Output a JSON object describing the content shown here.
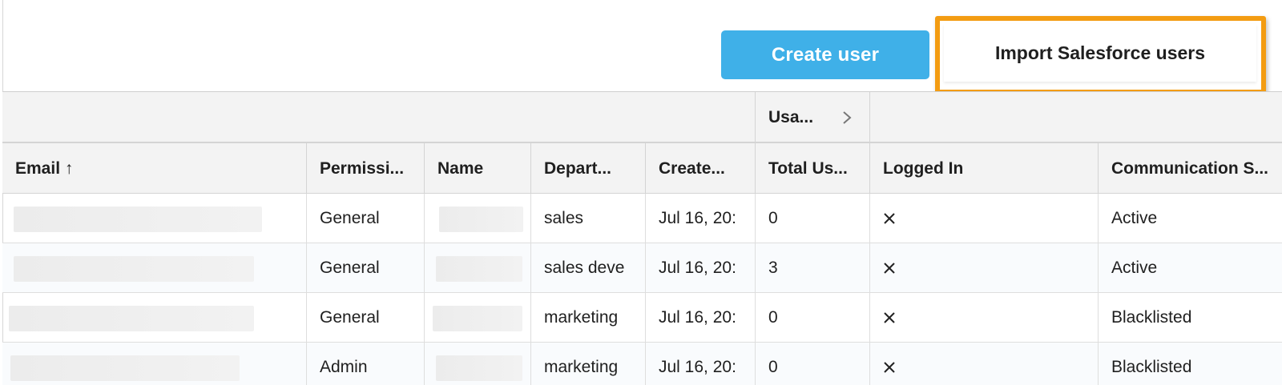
{
  "toolbar": {
    "create_label": "Create user",
    "import_label": "Import Salesforce users",
    "highlight_color": "#f39c12",
    "create_color": "#3fb0e8"
  },
  "table": {
    "group_header": {
      "usage_label": "Usa..."
    },
    "columns": [
      "Email ↑",
      "Permissi...",
      "Name",
      "Depart...",
      "Create...",
      "Total Us...",
      "Logged In",
      "Communication S..."
    ],
    "rows": [
      {
        "permission": "General",
        "department": "sales",
        "created": "Jul 16, 20:",
        "total_usage": "0",
        "logged_in_icon": "x-icon",
        "communication": "Active"
      },
      {
        "permission": "General",
        "department": "sales deve",
        "created": "Jul 16, 20:",
        "total_usage": "3",
        "logged_in_icon": "x-icon",
        "communication": "Active"
      },
      {
        "permission": "General",
        "department": "marketing",
        "created": "Jul 16, 20:",
        "total_usage": "0",
        "logged_in_icon": "x-icon",
        "communication": "Blacklisted"
      },
      {
        "permission": "Admin",
        "department": "marketing",
        "created": "Jul 16, 20:",
        "total_usage": "0",
        "logged_in_icon": "x-icon",
        "communication": "Blacklisted"
      }
    ]
  }
}
